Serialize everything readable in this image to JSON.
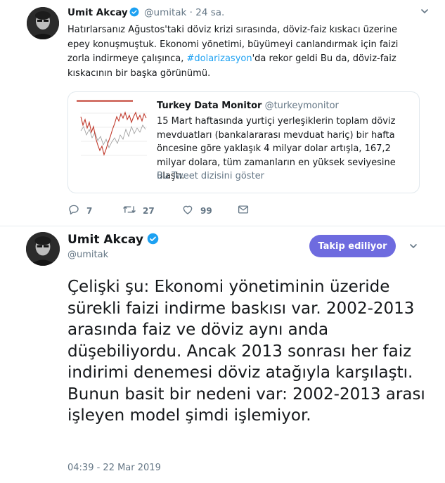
{
  "tweet": {
    "author_name": "Umit Akcay",
    "handle": "@umitak",
    "separator": "·",
    "time": "24 sa.",
    "text_before": "Hatırlarsanız Ağustos'taki döviz krizi sırasında, döviz-faiz kıskacı üzerine epey konuşmuştuk. Ekonomi yönetimi, büyümeyi canlandırmak için faizi zorla indirmeye çalışınca, ",
    "hashtag": "#dolarizasyon",
    "text_after": "'da rekor geldi Bu da, döviz-faiz kıskacının bir başka görünümü.",
    "quote": {
      "author_name": "Turkey Data Monitor",
      "handle": "@turkeymonitor",
      "text": "15 Mart haftasında yurtiçi yerleşiklerin toplam döviz mevduatları (bankalararası mevduat hariç) bir hafta öncesine göre yaklaşık 4 milyar dolar artışla, 167,2 milyar dolara, tüm zamanların en yüksek seviyesine ulaştı.",
      "show_thread": "Bu Tweet dizisini göster"
    },
    "actions": {
      "replies": "7",
      "retweets": "27",
      "likes": "99"
    }
  },
  "main_tweet": {
    "author_name": "Umit Akcay",
    "handle": "@umitak",
    "follow_label": "Takip ediliyor",
    "text": "Çelişki şu: Ekonomi yönetiminin üzeride sürekli faizi indirme baskısı var. 2002-2013 arasında faiz ve döviz aynı anda düşebiliyordu. Ancak 2013 sonrası her faiz indirimi denemesi döviz atağıyla karşılaştı. Bunun basit bir nedeni var: 2002-2013 arası işleyen model şimdi işlemiyor.",
    "timestamp": "04:39 - 22 Mar 2019"
  },
  "colors": {
    "verified": "#1da1f2",
    "hashtag": "#1da1f2",
    "follow_button": "#6e6bdf",
    "muted_text": "#657786",
    "chart_line": "#c0392b"
  },
  "icons": {
    "reply": "reply-icon",
    "retweet": "retweet-icon",
    "like": "heart-icon",
    "message": "envelope-icon",
    "verified": "verified-badge-icon",
    "menu": "chevron-down-icon"
  }
}
